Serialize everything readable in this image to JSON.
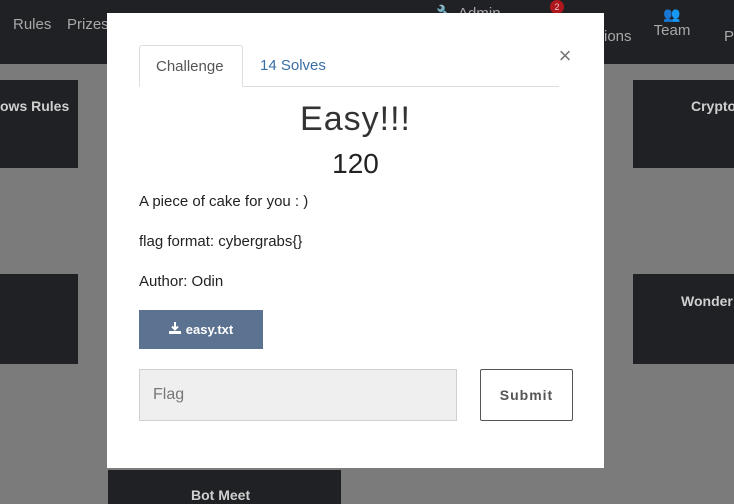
{
  "navbar": {
    "rules": "Rules",
    "prizes": "Prizes",
    "admin": "Admin",
    "notifications_badge": "2",
    "notifications_partial": "ions",
    "team": "Team",
    "partial_right": "P"
  },
  "background_cards": {
    "card1": "ows Rules",
    "card2": "Crypto",
    "card3": "Wonder",
    "card4": "Bot Meet"
  },
  "modal": {
    "tabs": [
      "Challenge",
      "14 Solves"
    ],
    "close_symbol": "×",
    "title": "Easy!!!",
    "points": "120",
    "description": [
      "A piece of cake for you : )",
      "flag format: cybergrabs{}",
      "Author: Odin"
    ],
    "file_button_label": "easy.txt",
    "flag_placeholder": "Flag",
    "submit_label": "Submit"
  },
  "colors": {
    "navbar_bg": "#1f2124",
    "overlay_bg": "#7b7b7b",
    "file_button_bg": "#5b7290",
    "tab_link": "#3a6ea5",
    "badge": "#b0161e"
  },
  "icons": [
    "wrench-icon",
    "bell-icon",
    "users-icon",
    "download-icon",
    "close-icon"
  ]
}
